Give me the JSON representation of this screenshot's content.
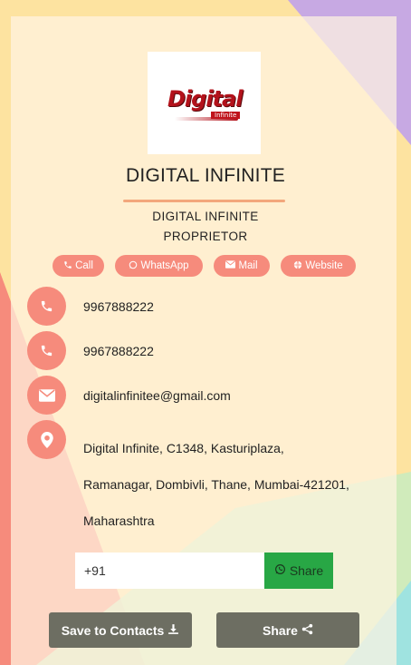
{
  "logo": {
    "main": "Digital",
    "sub": "Infinite"
  },
  "header": {
    "company_name": "DIGITAL INFINITE",
    "subtitle_line1": "DIGITAL INFINITE",
    "subtitle_line2": "PROPRIETOR"
  },
  "actions": {
    "call": "Call",
    "whatsapp": "WhatsApp",
    "mail": "Mail",
    "website": "Website"
  },
  "contacts": {
    "phone1": "9967888222",
    "phone2": "9967888222",
    "email": "digitalinfinitee@gmail.com",
    "address": "Digital Infinite, C1348, Kasturiplaza, Ramanagar, Dombivli, Thane, Mumbai-421201, Maharashtra"
  },
  "share_form": {
    "input_value": "+91",
    "share_label": "Share"
  },
  "footer": {
    "save_label": "Save to Contacts",
    "share_label": "Share"
  },
  "colors": {
    "accent": "#f68b7c",
    "whatsapp_green": "#28a745",
    "dark_button": "#6d6e62",
    "divider": "#f3a77c"
  }
}
